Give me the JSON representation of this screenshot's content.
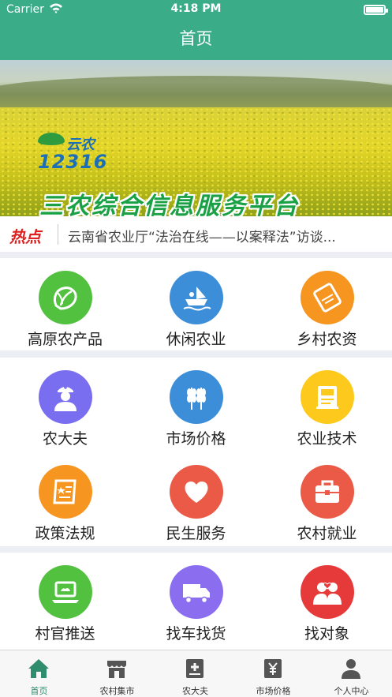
{
  "status_bar": {
    "carrier": "Carrier",
    "time": "4:18 PM",
    "battery_level": 1.0
  },
  "nav": {
    "title": "首页"
  },
  "banner": {
    "logo_top": "云农",
    "logo_number": "12316",
    "slogan": "三农综合信息服务平台"
  },
  "ticker": {
    "badge": "热点",
    "headline": "云南省农业厅“法治在线——以案释法”访谈..."
  },
  "grid": {
    "row1": [
      {
        "label": "高原农产品",
        "icon": "vegetable-icon",
        "color": "#52c13f"
      },
      {
        "label": "休闲农业",
        "icon": "boat-icon",
        "color": "#3c8ed8"
      },
      {
        "label": "乡村农资",
        "icon": "fertilizer-bag-icon",
        "color": "#f6951f"
      }
    ],
    "row2": [
      {
        "label": "农大夫",
        "icon": "doctor-icon",
        "color": "#7a6ef0"
      },
      {
        "label": "市场价格",
        "icon": "wheat-icon",
        "color": "#3c8ed8"
      },
      {
        "label": "农业技术",
        "icon": "book-icon",
        "color": "#fcc91c"
      }
    ],
    "row3": [
      {
        "label": "政策法规",
        "icon": "document-icon",
        "color": "#f6951f"
      },
      {
        "label": "民生服务",
        "icon": "heart-icon",
        "color": "#ea5a47"
      },
      {
        "label": "农村就业",
        "icon": "briefcase-icon",
        "color": "#ea5a47"
      }
    ],
    "row4": [
      {
        "label": "村官推送",
        "icon": "laptop-icon",
        "color": "#52c13f"
      },
      {
        "label": "找车找货",
        "icon": "truck-icon",
        "color": "#8b6ef0"
      },
      {
        "label": "找对象",
        "icon": "couple-icon",
        "color": "#e63a3a"
      }
    ]
  },
  "tabs": [
    {
      "label": "首页",
      "icon": "home-icon",
      "active": true
    },
    {
      "label": "农村集市",
      "icon": "market-icon",
      "active": false
    },
    {
      "label": "农大夫",
      "icon": "doctor-plus-icon",
      "active": false
    },
    {
      "label": "市场价格",
      "icon": "yen-tag-icon",
      "active": false
    },
    {
      "label": "个人中心",
      "icon": "person-icon",
      "active": false
    }
  ],
  "colors": {
    "brand": "#3bac88",
    "tab_active": "#2f8c6d",
    "hot": "#e02020"
  }
}
